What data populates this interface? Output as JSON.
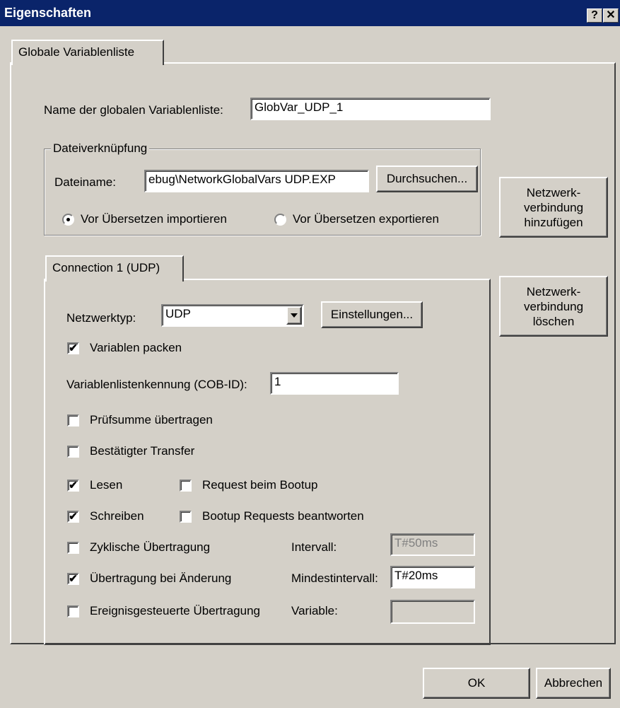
{
  "window": {
    "title": "Eigenschaften",
    "help_label": "?",
    "close_label": "✕"
  },
  "outer_tab": {
    "label": "Globale Variablenliste"
  },
  "list_name": {
    "label": "Name der globalen Variablenliste:",
    "value": "GlobVar_UDP_1"
  },
  "file_link": {
    "group_label": "Dateiverknüpfung",
    "filename_label": "Dateiname:",
    "filename_value": "ebug\\NetworkGlobalVars UDP.EXP",
    "browse_label": "Durchsuchen...",
    "import_label": "Vor Übersetzen importieren",
    "export_label": "Vor Übersetzen exportieren"
  },
  "side_buttons": {
    "add": [
      "Netzwerk-",
      "verbindung",
      "hinzufügen"
    ],
    "delete": [
      "Netzwerk-",
      "verbindung",
      "löschen"
    ]
  },
  "connection": {
    "tab_label": "Connection 1 (UDP)",
    "network_type_label": "Netzwerktyp:",
    "network_type_value": "UDP",
    "settings_label": "Einstellungen...",
    "pack_label": "Variablen packen",
    "cob_label": "Variablenlistenkennung (COB-ID):",
    "cob_value": "1",
    "checksum_label": "Prüfsumme übertragen",
    "confirmed_label": "Bestätigter Transfer",
    "read_label": "Lesen",
    "request_boot_label": "Request beim Bootup",
    "write_label": "Schreiben",
    "answer_boot_label": "Bootup Requests beantworten",
    "cyclic_label": "Zyklische Übertragung",
    "interval_label": "Intervall:",
    "interval_value": "T#50ms",
    "on_change_label": "Übertragung bei Änderung",
    "min_interval_label": "Mindestintervall:",
    "min_interval_value": "T#20ms",
    "event_label": "Ereignisgesteuerte Übertragung",
    "variable_label": "Variable:",
    "variable_value": ""
  },
  "footer": {
    "ok_label": "OK",
    "cancel_label": "Abbrechen"
  },
  "check_mark": "✔"
}
